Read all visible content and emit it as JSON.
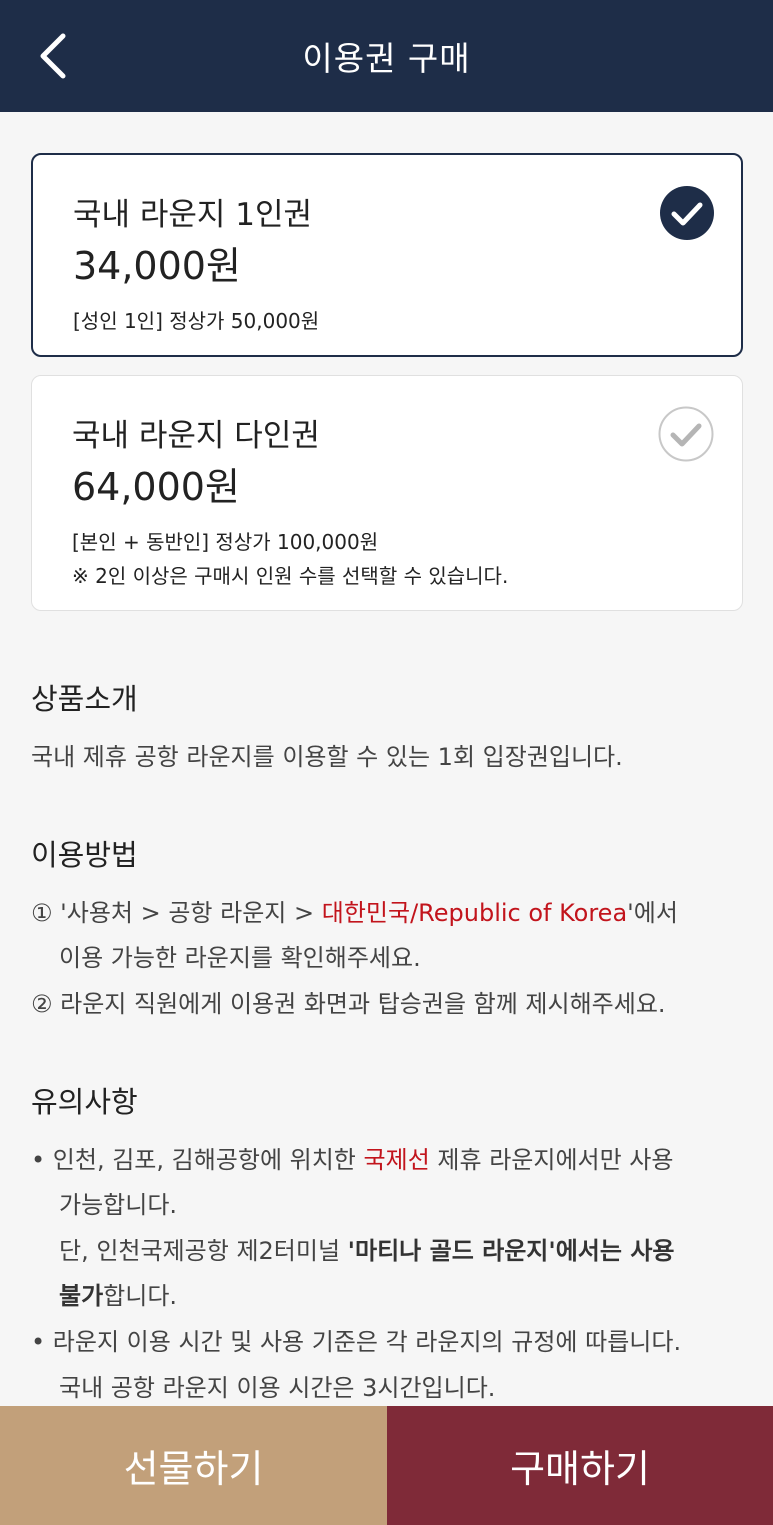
{
  "header": {
    "title": "이용권 구매"
  },
  "products": [
    {
      "name": "국내 라운지 1인권",
      "price": "34,000원",
      "note": "[성인 1인] 정상가 50,000원",
      "selected": true
    },
    {
      "name": "국내 라운지 다인권",
      "price": "64,000원",
      "note": "[본인 + 동반인] 정상가 100,000원",
      "note2": "※ 2인 이상은 구매시 인원 수를 선택할 수 있습니다.",
      "selected": false
    }
  ],
  "intro": {
    "title": "상품소개",
    "text": "국내 제휴 공항 라운지를 이용할 수 있는 1회 입장권입니다."
  },
  "usage": {
    "title": "이용방법",
    "step1_prefix": "① '사용처 > 공항 라운지 > ",
    "step1_highlight": "대한민국/Republic of Korea",
    "step1_suffix": "'에서",
    "step1_line2": "이용 가능한 라운지를 확인해주세요.",
    "step2": "② 라운지 직원에게 이용권 화면과 탑승권을 함께 제시해주세요."
  },
  "notice": {
    "title": "유의사항",
    "item1_prefix": "• 인천, 김포, 김해공항에 위치한 ",
    "item1_highlight": "국제선",
    "item1_suffix": " 제휴 라운지에서만 사용",
    "item1_line2": "가능합니다.",
    "item1_line3_prefix": "단, 인천국제공항 제2터미널 ",
    "item1_line3_bold": "'마티나 골드 라운지'에서는 사용",
    "item1_line4_bold": "불가",
    "item1_line4_suffix": "합니다.",
    "item2": "• 라운지 이용 시간 및 사용 기준은 각 라운지의 규정에 따릅니다.",
    "item2_line2": "국내 공항 라운지 이용 시간은 3시간입니다."
  },
  "actions": {
    "gift_label": "선물하기",
    "buy_label": "구매하기"
  },
  "colors": {
    "header": "#1e2d48",
    "gift": "#c2a07a",
    "buy": "#7f2a38",
    "highlight": "#c2141c"
  }
}
